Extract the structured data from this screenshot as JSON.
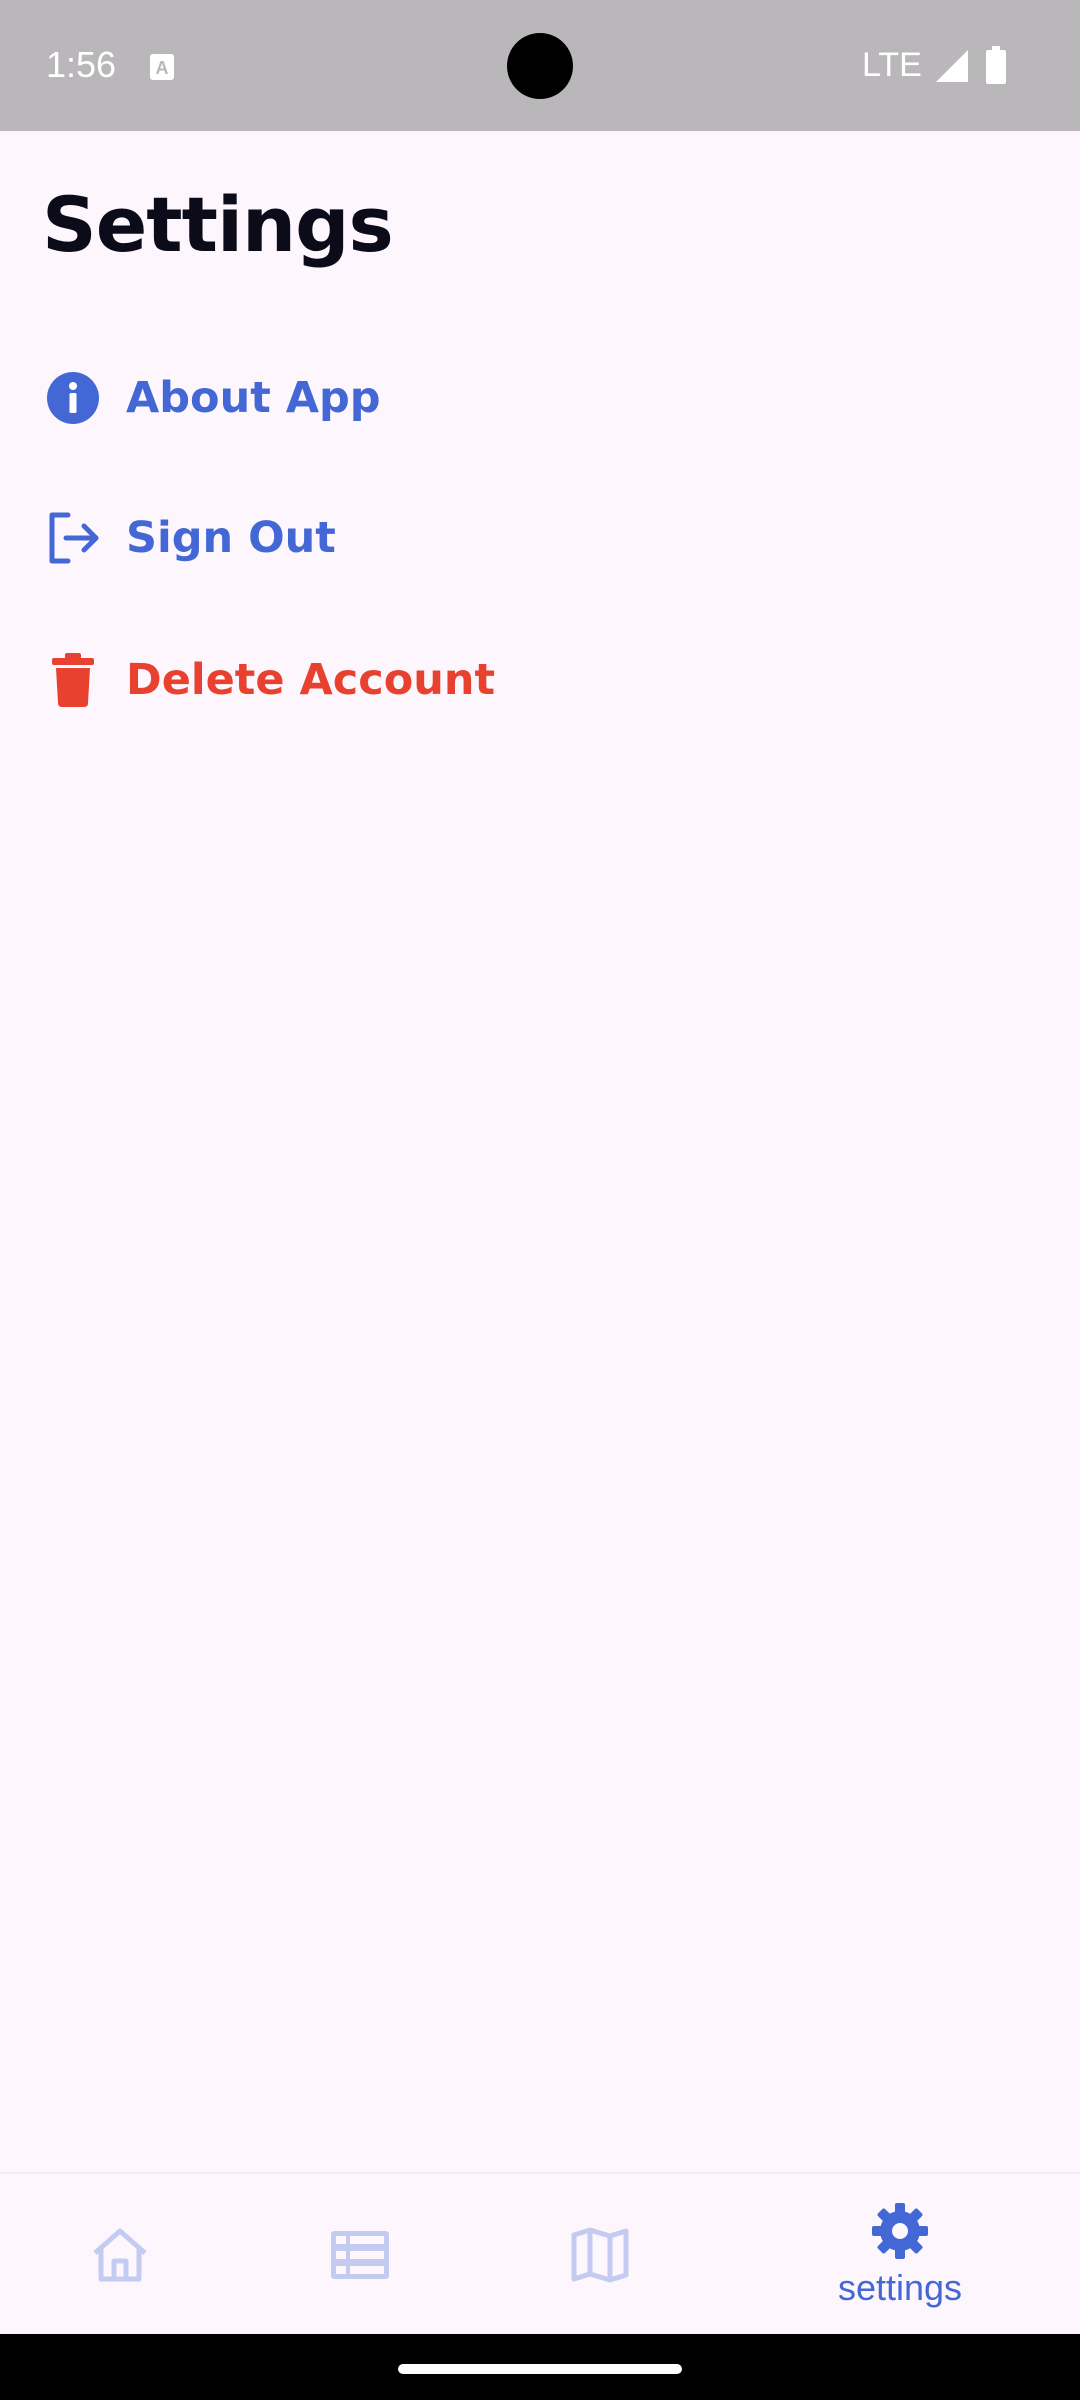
{
  "status_bar": {
    "time": "1:56",
    "network": "LTE",
    "icons": [
      "a-notification-icon",
      "signal-icon",
      "battery-icon"
    ]
  },
  "page": {
    "title": "Settings"
  },
  "menu": {
    "items": [
      {
        "label": "About App",
        "icon": "info-icon",
        "color": "#4467d6"
      },
      {
        "label": "Sign Out",
        "icon": "sign-out-icon",
        "color": "#4467d6"
      },
      {
        "label": "Delete Account",
        "icon": "trash-icon",
        "color": "#e8412f"
      }
    ]
  },
  "bottom_nav": {
    "items": [
      {
        "icon": "home-icon",
        "label": ""
      },
      {
        "icon": "list-icon",
        "label": ""
      },
      {
        "icon": "map-icon",
        "label": ""
      },
      {
        "icon": "gear-icon",
        "label": "settings",
        "active": true
      }
    ],
    "active_color": "#4467d6",
    "inactive_color": "#c3cbf0"
  },
  "colors": {
    "background": "#fdf7fd",
    "accent": "#4467d6",
    "danger": "#e8412f",
    "status_bar": "#bab7ba"
  }
}
